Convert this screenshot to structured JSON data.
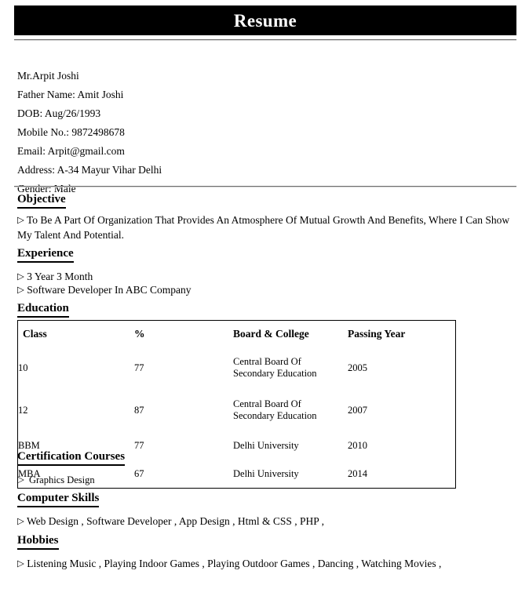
{
  "document": {
    "title": "Resume",
    "banner_background": "#000000",
    "banner_text_color": "#ffffff"
  },
  "bullet_glyph": "▷",
  "personal": {
    "name": "Mr.Arpit Joshi",
    "father_name": "Father Name: Amit Joshi",
    "dob": "DOB: Aug/26/1993",
    "mobile": "Mobile No.: 9872498678",
    "email": "Email: Arpit@gmail.com",
    "address": "Address: A-34 Mayur Vihar Delhi",
    "gender": "Gender: Male"
  },
  "sections": {
    "objective": {
      "heading": "Objective",
      "text": "To Be A Part Of Organization That Provides An Atmosphere Of Mutual Growth And Benefits, Where I Can Show My Talent And Potential."
    },
    "experience": {
      "heading": "Experience",
      "items": [
        "3 Year 3 Month",
        "Software Developer In ABC Company"
      ]
    },
    "education": {
      "heading": "Education",
      "columns": [
        "Class",
        "%",
        "Board & College",
        "Passing Year"
      ],
      "rows": [
        {
          "class": "10",
          "percent": "77",
          "board_line1": "Central Board Of",
          "board_line2": "Secondary Education",
          "year": "2005"
        },
        {
          "class": "12",
          "percent": "87",
          "board_line1": "Central Board Of",
          "board_line2": "Secondary Education",
          "year": "2007"
        },
        {
          "class": "BBM",
          "percent": "77",
          "board_line1": "Delhi University",
          "board_line2": "",
          "year": "2010"
        },
        {
          "class": "MBA",
          "percent": "67",
          "board_line1": "Delhi University",
          "board_line2": "",
          "year": "2014"
        }
      ]
    },
    "certification": {
      "heading": "Certification Courses",
      "items": [
        "Graphics Design"
      ]
    },
    "computer_skills": {
      "heading": "Computer Skills",
      "items": [
        "Web Design , Software Developer , App Design , Html & CSS , PHP ,"
      ]
    },
    "hobbies": {
      "heading": "Hobbies",
      "items": [
        "Listening Music , Playing Indoor Games , Playing Outdoor Games , Dancing , Watching Movies ,"
      ]
    }
  }
}
